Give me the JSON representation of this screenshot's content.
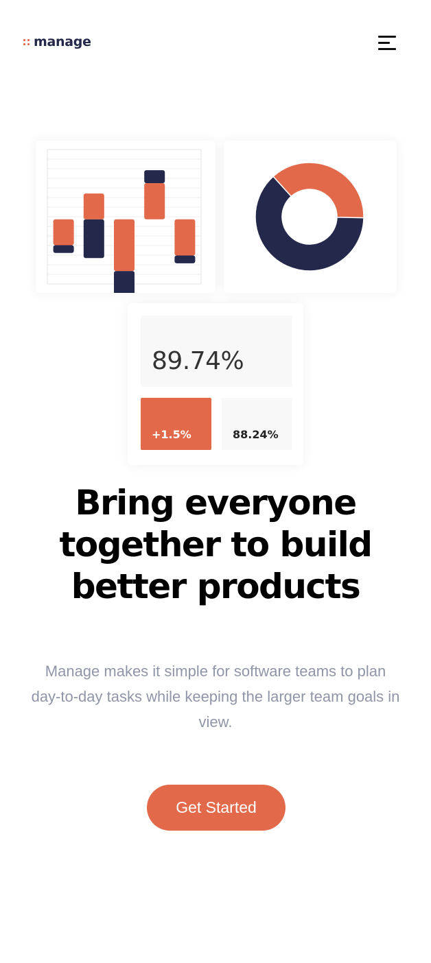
{
  "brand": {
    "name": "manage",
    "accent": "#e2694a",
    "navy": "#24284a"
  },
  "nav": {
    "menu_icon": "hamburger-menu-icon"
  },
  "hero": {
    "headline": "Bring everyone together to build better products",
    "description": "Manage makes it simple for software teams to plan day-to-day tasks while keeping the larger team goals in view.",
    "cta_label": "Get Started"
  },
  "stats": {
    "main_value": "89.74%",
    "change_value": "+1.5%",
    "previous_value": "88.24%"
  },
  "chart_data": [
    {
      "type": "bar",
      "series": [
        {
          "name": "",
          "color": "#e2694a",
          "values": [
            -1,
            1,
            -2,
            1.4,
            -1.4
          ]
        },
        {
          "name": "",
          "color": "#24284a",
          "values": [
            -0.3,
            -1.5,
            -1,
            0.5,
            -0.3
          ]
        }
      ],
      "categories": [
        "",
        "",
        "",
        "",
        ""
      ],
      "ylim": [
        -2.5,
        2.7
      ],
      "grid": true
    },
    {
      "type": "pie",
      "donut": true,
      "slices": [
        {
          "name": "",
          "value": 37,
          "color": "#e2694a"
        },
        {
          "name": "",
          "value": 63,
          "color": "#24284a"
        }
      ]
    }
  ]
}
